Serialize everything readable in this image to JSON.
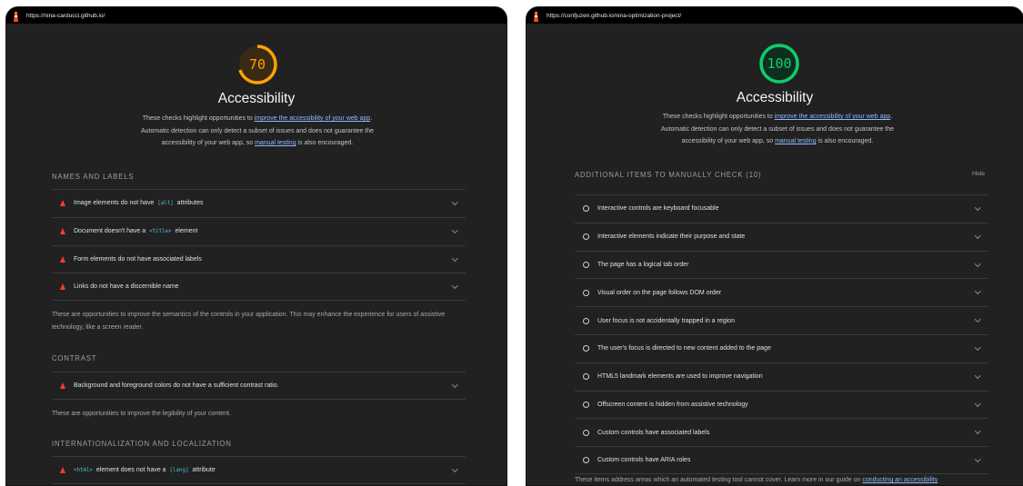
{
  "left": {
    "url": "https://nina-carducci.github.io/",
    "score": "70",
    "score_color": "#ffa400",
    "score_fraction": 0.7,
    "title": "Accessibility",
    "desc_pre": "These checks highlight opportunities to ",
    "desc_link1": "improve the accessibility of your web app",
    "desc_mid": ". Automatic detection can only detect a subset of issues and does not guarantee the accessibility of your web app, so ",
    "desc_link2": "manual testing",
    "desc_post": " is also encouraged.",
    "groups": {
      "names": {
        "title": "NAMES AND LABELS",
        "a1_pre": "Image elements do not have ",
        "a1_code": "[alt]",
        "a1_post": " attributes",
        "a2_pre": "Document doesn't have a ",
        "a2_code": "<title>",
        "a2_post": " element",
        "a3": "Form elements do not have associated labels",
        "a4": "Links do not have a discernible name",
        "footer": "These are opportunities to improve the semantics of the controls in your application. This may enhance the experience for users of assistive technology, like a screen reader."
      },
      "contrast": {
        "title": "CONTRAST",
        "a1": "Background and foreground colors do not have a sufficient contrast ratio.",
        "footer": "These are opportunities to improve the legibility of your content."
      },
      "i18n": {
        "title": "INTERNATIONALIZATION AND LOCALIZATION",
        "a1_code1": "<html>",
        "a1_mid": " element does not have a ",
        "a1_code2": "[lang]",
        "a1_post": " attribute"
      }
    }
  },
  "right": {
    "url": "https://confjuzen.github.io/nina-optimization-project/",
    "score": "100",
    "score_color": "#0cce6b",
    "score_fraction": 1.0,
    "title": "Accessibility",
    "desc_pre": "These checks highlight opportunities to ",
    "desc_link1": "improve the accessibility of your web app",
    "desc_mid": ". Automatic detection can only detect a subset of issues and does not guarantee the accessibility of your web app, so ",
    "desc_link2": "manual testing",
    "desc_post": " is also encouraged.",
    "manual_title": "ADDITIONAL ITEMS TO MANUALLY CHECK (10)",
    "hide_label": "Hide",
    "items": [
      "Interactive controls are keyboard focusable",
      "Interactive elements indicate their purpose and state",
      "The page has a logical tab order",
      "Visual order on the page follows DOM order",
      "User focus is not accidentally trapped in a region",
      "The user's focus is directed to new content added to the page",
      "HTML5 landmark elements are used to improve navigation",
      "Offscreen content is hidden from assistive technology",
      "Custom controls have associated labels",
      "Custom controls have ARIA roles"
    ],
    "footer_pre": "These items address areas which an automated testing tool cannot cover. Learn more in our guide on ",
    "footer_link": "conducting an accessibility"
  },
  "icons": {
    "logo": "lighthouse-icon",
    "fail": "red-triangle-icon",
    "manual": "circle-icon",
    "expand": "chevron-down-icon"
  }
}
